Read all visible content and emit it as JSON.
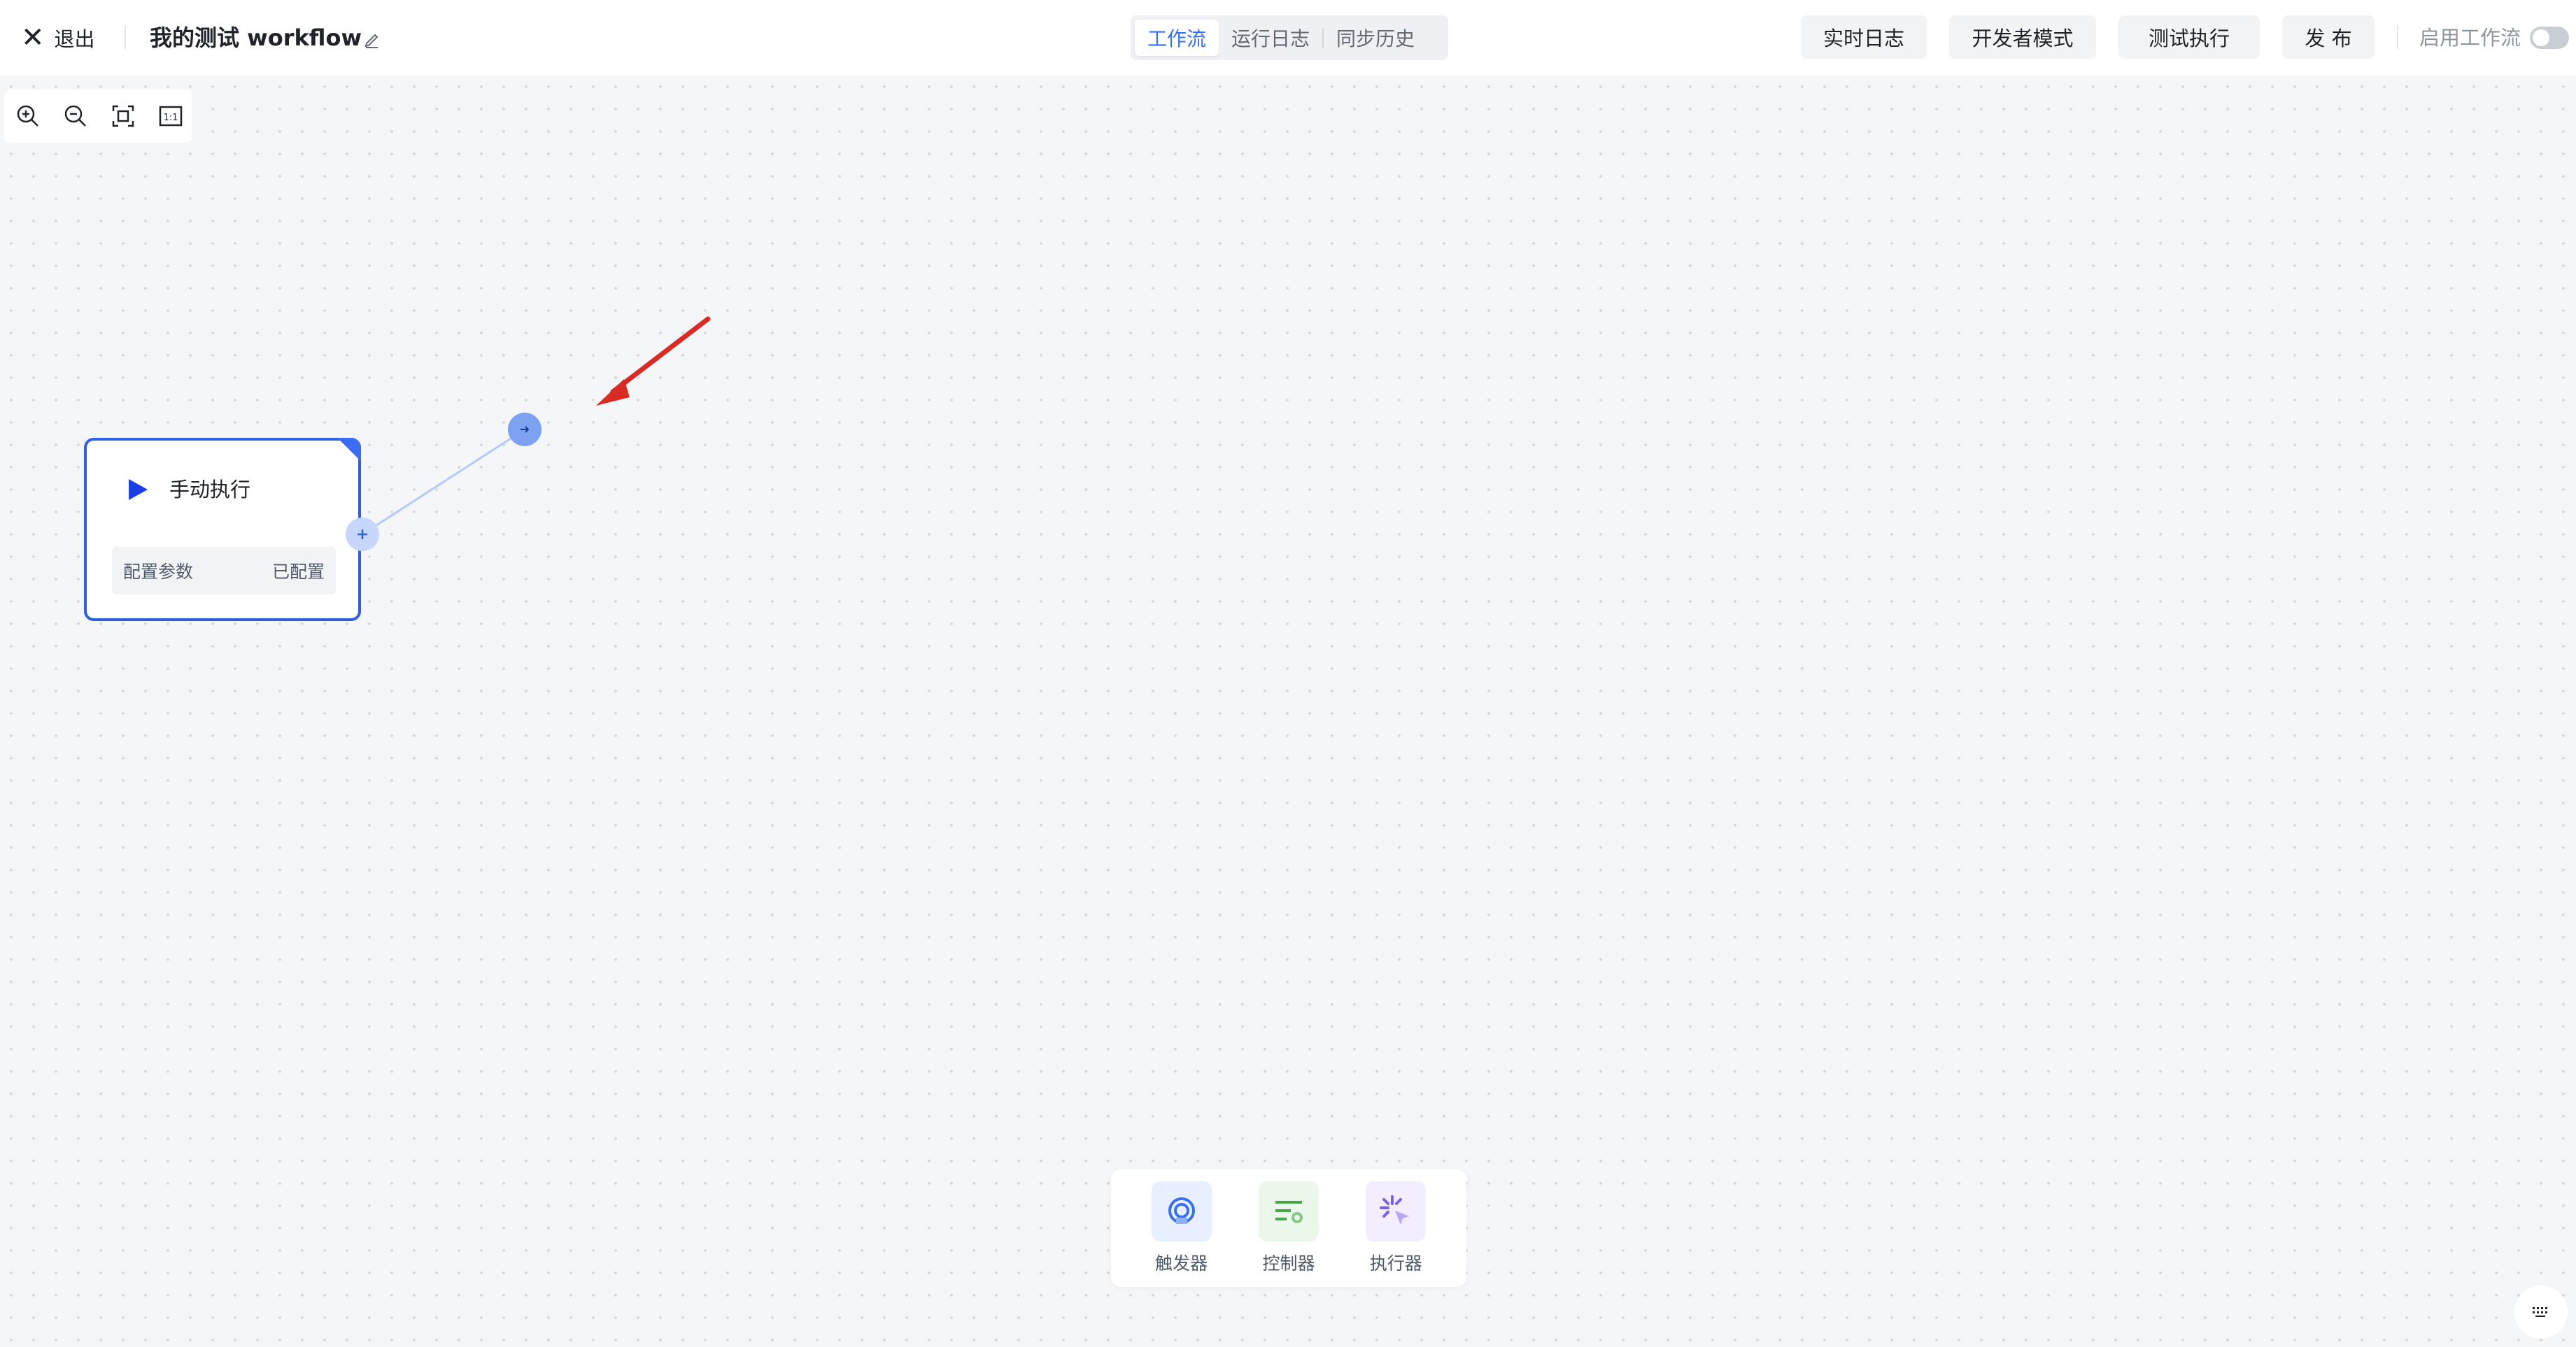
{
  "header": {
    "exit_label": "退出",
    "workflow_title": "我的测试 workflow",
    "tabs": [
      {
        "label": "工作流",
        "active": true
      },
      {
        "label": "运行日志",
        "active": false
      },
      {
        "label": "同步历史",
        "active": false
      }
    ],
    "buttons": {
      "realtime_log": "实时日志",
      "developer_mode": "开发者模式",
      "test_run": "测试执行",
      "publish": "发 布"
    },
    "enable_workflow_label": "启用工作流",
    "enable_workflow_on": false
  },
  "zoom_toolbar": {
    "icons": [
      "zoom-in-icon",
      "zoom-out-icon",
      "fit-view-icon",
      "actual-size-icon"
    ],
    "actual_size_text": "1:1"
  },
  "node": {
    "title": "手动执行",
    "config_label": "配置参数",
    "config_status": "已配置",
    "icon": "play-icon"
  },
  "palette": {
    "items": [
      {
        "label": "触发器",
        "icon": "trigger-icon"
      },
      {
        "label": "控制器",
        "icon": "controller-icon"
      },
      {
        "label": "执行器",
        "icon": "executor-icon"
      }
    ]
  },
  "colors": {
    "accent": "#3370ff",
    "node_border": "#2f5fe4",
    "annotation_arrow": "#d92b25"
  }
}
